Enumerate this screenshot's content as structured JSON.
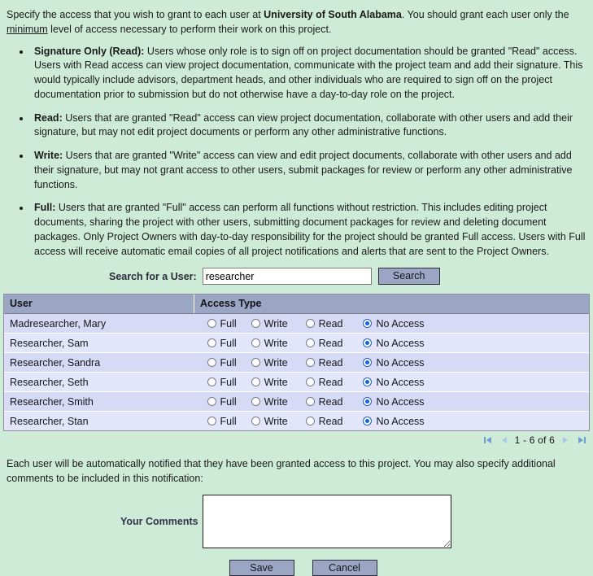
{
  "intro": {
    "before_org": "Specify the access that you wish to grant to each user at ",
    "org": "University of South Alabama",
    "after_org": ". You should grant each user only the ",
    "emphasis": "minimum",
    "tail": " level of access necessary to perform their work on this project."
  },
  "access_levels": [
    {
      "term": "Signature Only (Read):",
      "description": " Users whose only role is to sign off on project documentation should be granted \"Read\" access. Users with Read access can view project documentation, communicate with the project team and add their signature. This would typically include advisors, department heads, and other individuals who are required to sign off on the project documentation prior to submission but do not otherwise have a day-to-day role on the project."
    },
    {
      "term": "Read:",
      "description": " Users that are granted \"Read\" access can view project documentation, collaborate with other users and add their signature, but may not edit project documents or perform any other administrative functions."
    },
    {
      "term": "Write:",
      "description": " Users that are granted \"Write\" access can view and edit project documents, collaborate with other users and add their signature, but may not grant access to other users, submit packages for review or perform any other administrative functions."
    },
    {
      "term": "Full:",
      "description": " Users that are granted \"Full\" access can perform all functions without restriction. This includes editing project documents, sharing the project with other users, submitting document packages for review and deleting document packages. Only Project Owners with day-to-day responsibility for the project should be granted Full access. Users with Full access will receive automatic email copies of all project notifications and alerts that are sent to the Project Owners."
    }
  ],
  "search": {
    "label": "Search for a User:",
    "value": "researcher",
    "placeholder": "",
    "button_label": "Search"
  },
  "grid": {
    "columns": [
      "User",
      "Access Type"
    ],
    "access_options": [
      "Full",
      "Write",
      "Read",
      "No Access"
    ],
    "rows": [
      {
        "user": "Madresearcher, Mary",
        "selected": "No Access"
      },
      {
        "user": "Researcher, Sam",
        "selected": "No Access"
      },
      {
        "user": "Researcher, Sandra",
        "selected": "No Access"
      },
      {
        "user": "Researcher, Seth",
        "selected": "No Access"
      },
      {
        "user": "Researcher, Smith",
        "selected": "No Access"
      },
      {
        "user": "Researcher, Stan",
        "selected": "No Access"
      }
    ]
  },
  "pager": {
    "first_icon": "first-page-icon",
    "prev_icon": "previous-page-icon",
    "range_text": "1 - 6 of 6",
    "next_icon": "next-page-icon",
    "last_icon": "last-page-icon"
  },
  "notification": {
    "text": "Each user will be automatically notified that they have been granted access to this project. You may also specify additional comments to be included in this notification:"
  },
  "comments": {
    "label": "Your Comments",
    "value": "",
    "placeholder": ""
  },
  "actions": {
    "save_label": "Save",
    "cancel_label": "Cancel"
  },
  "colors": {
    "page_background": "#cdebd6",
    "header_row": "#9aa6c4",
    "row_odd": "#d7daf5",
    "row_even": "#e3e6fb",
    "button_face": "#9aa6c4",
    "radio_selected": "#1166e0",
    "pager_active": "#6c9ed4",
    "pager_disabled": "#a9c8e6"
  }
}
